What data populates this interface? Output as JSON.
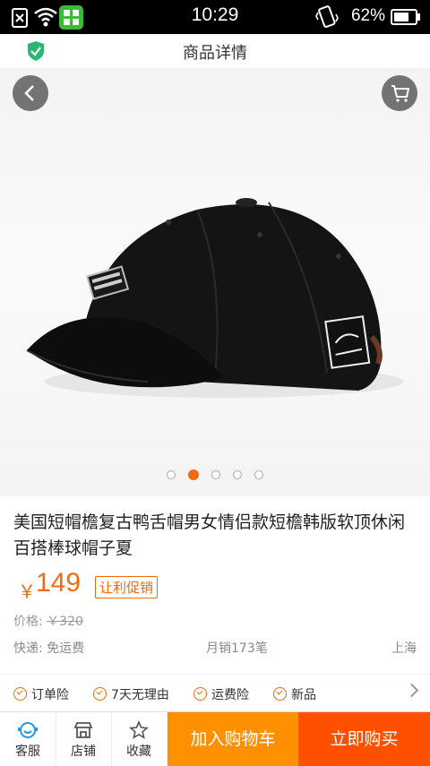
{
  "status_bar": {
    "time": "10:29",
    "battery_percent": "62%",
    "icons": [
      "sim-card-icon",
      "wifi-icon",
      "app-grid-icon",
      "phone-vibrate-icon",
      "battery-icon"
    ]
  },
  "header": {
    "title": "商品详情"
  },
  "gallery": {
    "image_count": 5,
    "active_index": 1,
    "subject": "black baseball cap"
  },
  "product": {
    "title": "美国短帽檐复古鸭舌帽男女情侣款短檐韩版软顶休闲百搭棒球帽子夏",
    "currency": "￥",
    "price": "149",
    "promo_label": "让利促销",
    "original_price_label": "价格:",
    "original_price": "￥320",
    "shipping": "快递: 免运费",
    "monthly_sales": "月销173笔",
    "location": "上海"
  },
  "services": [
    {
      "label": "订单险"
    },
    {
      "label": "7天无理由"
    },
    {
      "label": "运费险"
    },
    {
      "label": "新品"
    }
  ],
  "bottom_bar": {
    "customer_service": "客服",
    "store": "店铺",
    "favorite": "收藏",
    "add_to_cart": "加入购物车",
    "buy_now": "立即购买"
  },
  "colors": {
    "accent": "#f06a0f",
    "add_to_cart_bg": "#ff9000",
    "buy_now_bg": "#ff5000",
    "shield": "#2bb673"
  }
}
